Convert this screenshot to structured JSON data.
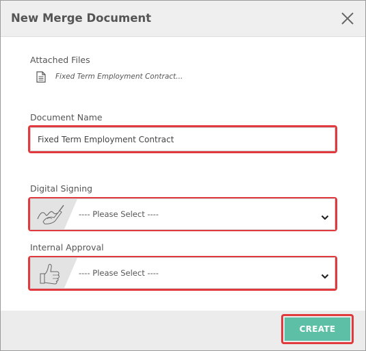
{
  "dialog": {
    "title": "New Merge Document",
    "close_icon": "close-icon"
  },
  "attached": {
    "label": "Attached Files",
    "icon": "document-icon",
    "files": [
      "Fixed Term Employment Contract..."
    ]
  },
  "document_name": {
    "label": "Document Name",
    "value": "Fixed Term Employment Contract"
  },
  "digital_signing": {
    "label": "Digital Signing",
    "icon": "signature-pen-icon",
    "selected": "---- Please Select ----"
  },
  "internal_approval": {
    "label": "Internal Approval",
    "icon": "thumbs-up-icon",
    "selected": "---- Please Select ----"
  },
  "footer": {
    "create_label": "CREATE"
  },
  "colors": {
    "accent": "#5cbfa6",
    "highlight": "#e0393e",
    "header_bg": "#efefef"
  }
}
